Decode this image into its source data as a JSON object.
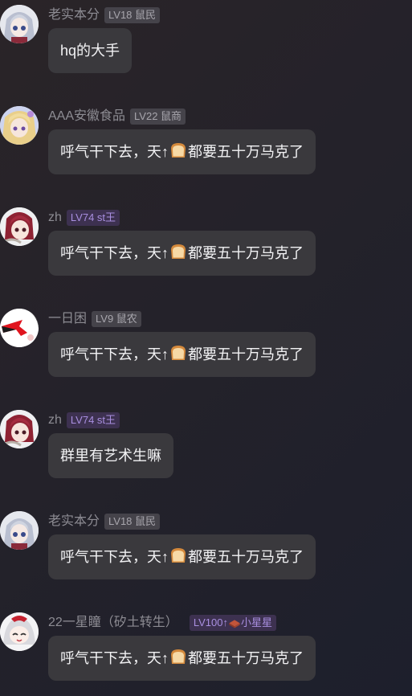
{
  "messages": [
    {
      "user": "老实本分",
      "badge": "LV18 鼠民",
      "badge_style": "gray",
      "avatar": "anime-girl-silver-hair-avatar",
      "parts": [
        "hq的大手"
      ]
    },
    {
      "user": "AAA安徽食品",
      "badge": "LV22 鼠商",
      "badge_style": "gray",
      "avatar": "anime-blonde-avatar",
      "parts": [
        "呼气干下去，天",
        "↑",
        "🍞",
        "都要五十万马克了"
      ]
    },
    {
      "user": "zh",
      "badge": "LV74 st王",
      "badge_style": "purple",
      "avatar": "anime-red-hair-avatar",
      "parts": [
        "呼气干下去，天",
        "↑",
        "🍞",
        "都要五十万马克了"
      ]
    },
    {
      "user": "一日困",
      "badge": "LV9 鼠农",
      "badge_style": "gray",
      "avatar": "red-arrow-avatar",
      "parts": [
        "呼气干下去，天",
        "↑",
        "🍞",
        "都要五十万马克了"
      ]
    },
    {
      "user": "zh",
      "badge": "LV74 st王",
      "badge_style": "purple",
      "avatar": "anime-red-hair-avatar",
      "parts": [
        "群里有艺术生嘛"
      ]
    },
    {
      "user": "老实本分",
      "badge": "LV18 鼠民",
      "badge_style": "gray",
      "avatar": "anime-girl-silver-hair-avatar",
      "parts": [
        "呼气干下去，天",
        "↑",
        "🍞",
        "都要五十万马克了"
      ]
    },
    {
      "user": "22一星瞳（矽土转生）",
      "badge_parts": [
        "LV100",
        "↑",
        "🧱",
        "小星星"
      ],
      "badge_style": "purple",
      "avatar": "chibi-white-hair-avatar",
      "parts": [
        "呼气干下去，天",
        "↑",
        "🍞",
        "都要五十万马克了"
      ]
    }
  ],
  "colors": {
    "bubble": "#3a393d",
    "name": "#8d8c93",
    "badge_gray": "#45434a",
    "badge_purple": "#3d3150",
    "text": "#f2f2f4"
  }
}
